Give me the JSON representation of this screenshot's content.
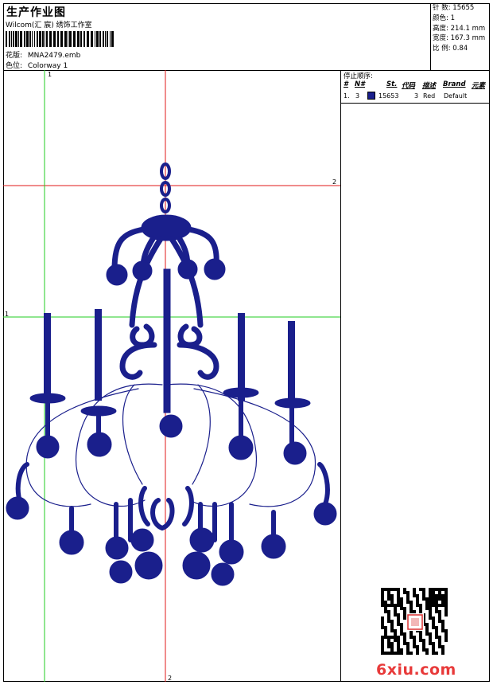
{
  "header": {
    "title": "生产作业图",
    "company": "Wilcom(汇 宸) 绣饰工作室",
    "design_label": "花版:",
    "design_value": "MNA2479.emb",
    "colorway_label": "色位:",
    "colorway_value": "Colorway 1"
  },
  "stats": [
    {
      "label": "针 数:",
      "value": "15655"
    },
    {
      "label": "颜色:",
      "value": "1"
    },
    {
      "label": "高度:",
      "value": "214.1 mm"
    },
    {
      "label": "宽度:",
      "value": "167.3 mm"
    },
    {
      "label": "比 例:",
      "value": "0.84"
    }
  ],
  "guides": {
    "vertical_red_label": "2",
    "vertical_red_bottom_label": "2",
    "horizontal_red_label": "2",
    "vertical_green_label": "1",
    "horizontal_green_label": "1"
  },
  "stop_sequence": {
    "title": "停止顺序:",
    "columns": [
      "#",
      "N#",
      "St.",
      "代码",
      "描述",
      "Brand",
      "元素"
    ],
    "rows": [
      {
        "index": "1.",
        "needle": "3",
        "stitches": "15653",
        "code": "3",
        "description": "Red",
        "brand": "Default",
        "color": "#1a1f8c"
      }
    ]
  },
  "watermark": {
    "site": "6xiu.com"
  },
  "colors": {
    "thread": "#1a1f8c",
    "guide_red": "#e01818",
    "guide_green": "#22cc22"
  }
}
